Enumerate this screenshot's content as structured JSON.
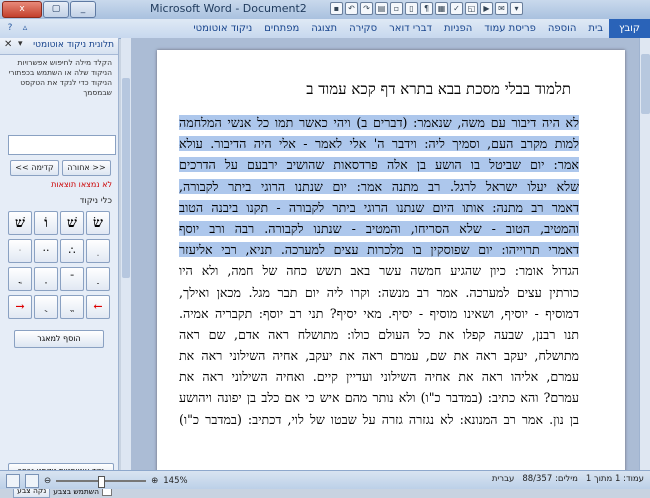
{
  "window": {
    "title": "Microsoft Word - Document2",
    "buttons": {
      "close": "x",
      "maximize": "▢",
      "minimize": "_"
    }
  },
  "ribbon": {
    "tabs": [
      "קובץ",
      "בית",
      "הוספה",
      "פריסת עמוד",
      "הפניות",
      "דברי דואר",
      "סקירה",
      "תצוגה",
      "מפתחים",
      "ניקוד אוטומטי"
    ]
  },
  "pane": {
    "title": "תלונית ניקוד אוטומטי",
    "description": "הקלד מילה לחיפוש אפשרויות הניקוד שלה או השתמש בכפתורי הניקוד כדי לנקד את הטקסט שבמסמך",
    "search_placeholder": "",
    "prev_label": "<< אחורה",
    "next_label": "קדימה >>",
    "not_found": "לא נמצאו תוצאות",
    "tools_label": "כלי ניקוד",
    "keys": [
      {
        "glyph": "שׁ",
        "big": true
      },
      {
        "glyph": "וֹ",
        "big": true
      },
      {
        "glyph": "שׁ",
        "big": true
      },
      {
        "glyph": "שׂ",
        "big": true
      },
      {
        "glyph": "ּ"
      },
      {
        "glyph": "··"
      },
      {
        "glyph": "∴"
      },
      {
        "glyph": "ֽ"
      },
      {
        "glyph": "ֳ"
      },
      {
        "glyph": "ָ"
      },
      {
        "glyph": "־"
      },
      {
        "glyph": "ֵ"
      },
      {
        "glyph": "→",
        "red": true
      },
      {
        "glyph": "ֻ"
      },
      {
        "glyph": "ֱ"
      },
      {
        "glyph": "←",
        "red": true
      }
    ],
    "add_label": "הוסף למאגר",
    "auto_button": "נקד אוטומטית טקסט נבחר",
    "checkbox_label": "השתמש בצבע",
    "small_button": "נקה צבע"
  },
  "doc": {
    "heading": "תלמוד בבלי מסכת בבא בתרא דף קכא עמוד ב",
    "lines": [
      {
        "text": "לא היה דיבור עם משה, שנאמר: (דברים ב) ויהי כאשר תמו כל אנשי המלחמה",
        "sel": true
      },
      {
        "text": "למות מקרב העם, וסמיך ליה: וידבר ה' אלי לאמר - אלי היה הדיבור. עולא",
        "sel": true
      },
      {
        "text": "אמר: יום שביטל בו הושע בן אלה פרדסאות שהושיב ירבעם על הדרכים",
        "sel": true
      },
      {
        "text": "שלא יעלו ישראל לרגל. רב מתנה אמר: יום שנתנו הרוגי ביתר לקבורה,",
        "sel": true
      },
      {
        "text": "דאמר רב מתנה: אותו היום שנתנו הרוגי ביתר לקבורה - תקנו ביבנה הטוב",
        "sel": true
      },
      {
        "text": "והמטיב, הטוב - שלא הסריחו, והמטיב - שנתנו לקבורה. רבה ורב יוסף",
        "sel": true
      },
      {
        "text": "דאמרי תרוייהו: יום שפוסקין בו מלכרות עצים למערכה. תניא, רבי אליעזר",
        "sel": true
      },
      {
        "text": "הגדול אומר: כיון שהגיע חמשה עשר באב תשש כחה של חמה, ולא היו",
        "sel": false
      },
      {
        "text": "כורתין עצים למערכה. אמר רב מנשה: וקרו ליה יום תבר מגל. מכאן ואילך,",
        "sel": false
      },
      {
        "text": "דמוסיף - יוסיף, ושאינו מוסיף - יסיף. מאי יסיף? תני רב יוסף: תקבריה אמיה.",
        "sel": false
      },
      {
        "text": "תנו רבנן, שבעה קפלו את כל העולם כולו: מתושלח ראה אדם, שם ראה",
        "sel": false
      },
      {
        "text": "מתושלח, יעקב ראה את שם, עמרם ראה את יעקב, אחיה השילוני ראה את",
        "sel": false
      },
      {
        "text": "עמרם, אליהו ראה את אחיה השילוני ועדיין קיים. ואחיה השילוני ראה את",
        "sel": false
      },
      {
        "text": "עמרם? והא כתיב: (במדבר כ\"ו) ולא נותר מהם איש כי אם כלב בן יפונה ויהושע",
        "sel": false
      },
      {
        "text": "בן נון. אמר רב המנונא: לא נגזרה גזרה על שבטו של לוי, דכתיב: (במדבר כ\"ו)",
        "sel": false
      }
    ]
  },
  "status": {
    "zoom": "145%",
    "page": "עמוד: 1 מתוך 1",
    "words": "מילים: 88/357",
    "language": "עברית"
  }
}
